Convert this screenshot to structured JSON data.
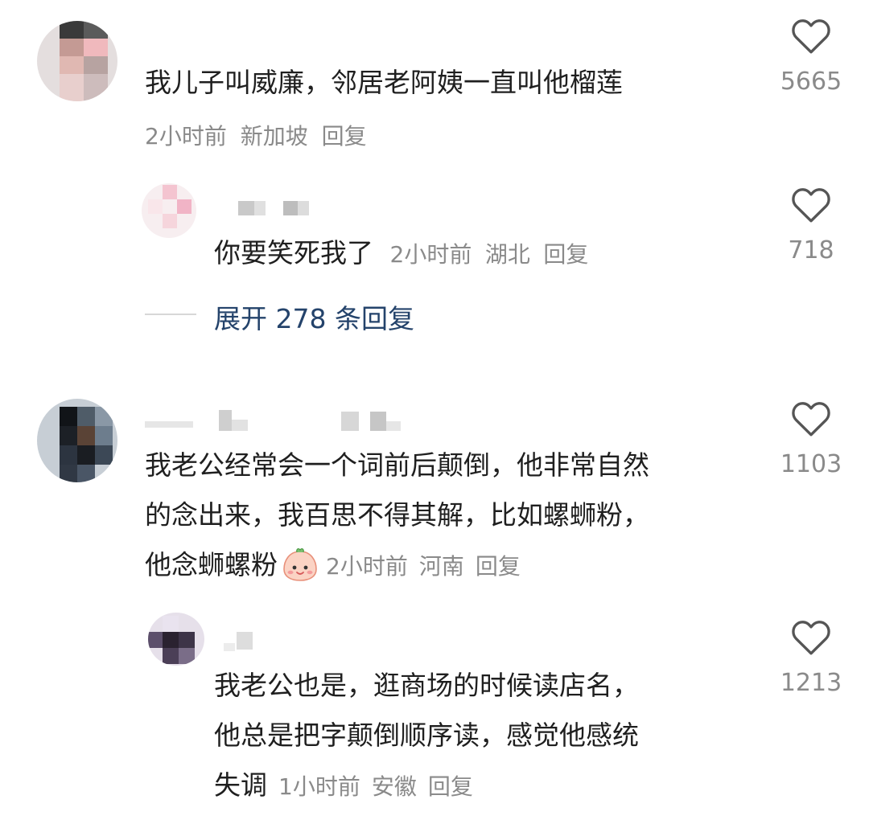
{
  "colors": {
    "text": "#1f1f1f",
    "meta": "#8a8a8a",
    "link": "#24436b",
    "icon": "#555555"
  },
  "comments": [
    {
      "text": "我儿子叫威廉，邻居老阿姨一直叫他榴莲",
      "time": "2小时前",
      "location": "新加坡",
      "reply_label": "回复",
      "likes": "5665",
      "like_icon": "heart-outline-icon",
      "replies": [
        {
          "text": "你要笑死我了",
          "time": "2小时前",
          "location": "湖北",
          "reply_label": "回复",
          "likes": "718",
          "like_icon": "heart-outline-icon"
        }
      ],
      "expand_label": "展开 278 条回复"
    },
    {
      "text_lines": [
        "我老公经常会一个词前后颠倒，他非常自然",
        "的念出来，我百思不得其解，比如螺蛳粉，",
        "他念蛳螺粉"
      ],
      "emoji": "blush-face-emoji",
      "time": "2小时前",
      "location": "河南",
      "reply_label": "回复",
      "likes": "1103",
      "like_icon": "heart-outline-icon",
      "replies": [
        {
          "text_lines": [
            "我老公也是，逛商场的时候读店名，",
            "他总是把字颠倒顺序读，感觉他感统",
            "失调"
          ],
          "time": "1小时前",
          "location": "安徽",
          "reply_label": "回复",
          "likes": "1213",
          "like_icon": "heart-outline-icon"
        }
      ]
    }
  ]
}
